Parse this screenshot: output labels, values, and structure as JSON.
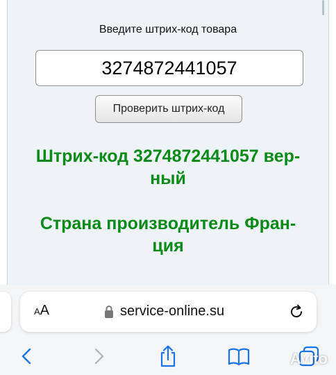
{
  "form": {
    "prompt": "Введите штрих-код товара",
    "barcode_value": "3274872441057",
    "check_button_label": "Проверить штрих-код"
  },
  "results": {
    "valid_line1": "Штрих-код 3274872441057 вер-",
    "valid_line2": "ный",
    "country_line1": "Страна производитель Фран-",
    "country_line2": "ция"
  },
  "browser": {
    "aa_small": "A",
    "aa_large": "A",
    "url": "service-online.su"
  },
  "watermark": "Avito",
  "colors": {
    "result_green": "#0a8a17",
    "accent_blue": "#1a73e8",
    "page_background": "#eef3f8"
  },
  "icons": {
    "lock": "lock-icon",
    "reload": "reload-icon",
    "back": "chevron-left-icon",
    "forward": "chevron-right-icon",
    "share": "share-icon",
    "bookmarks": "book-icon",
    "tabs": "tabs-icon"
  }
}
